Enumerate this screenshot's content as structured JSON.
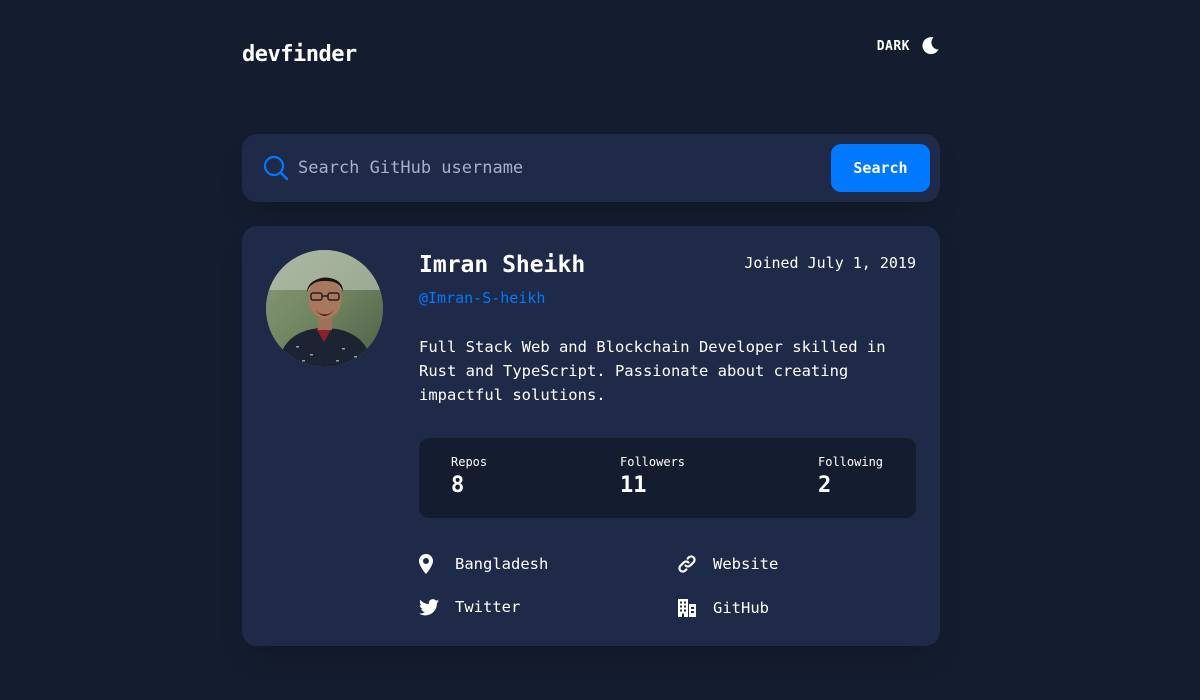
{
  "header": {
    "logo": "devfinder",
    "theme_toggle_label": "DARK"
  },
  "search": {
    "placeholder": "Search GitHub username",
    "value": "",
    "button_label": "Search"
  },
  "profile": {
    "name": "Imran Sheikh",
    "handle": "@Imran-S-heikh",
    "joined": "Joined July 1, 2019",
    "bio": "Full Stack Web and Blockchain Developer skilled in Rust and TypeScript. Passionate about creating impactful solutions.",
    "stats": {
      "repos_label": "Repos",
      "repos_value": "8",
      "followers_label": "Followers",
      "followers_value": "11",
      "following_label": "Following",
      "following_value": "2"
    },
    "links": {
      "location": "Bangladesh",
      "website": "Website",
      "twitter": "Twitter",
      "company": "GitHub"
    }
  },
  "icons": {
    "theme": "moon-icon",
    "search": "search-icon",
    "location": "location-pin-icon",
    "website": "link-icon",
    "twitter": "twitter-icon",
    "company": "building-icon"
  },
  "colors": {
    "background": "#141d2f",
    "card": "#1e2a47",
    "accent": "#0079ff",
    "text": "#ffffff",
    "muted": "#a6b1c8"
  }
}
